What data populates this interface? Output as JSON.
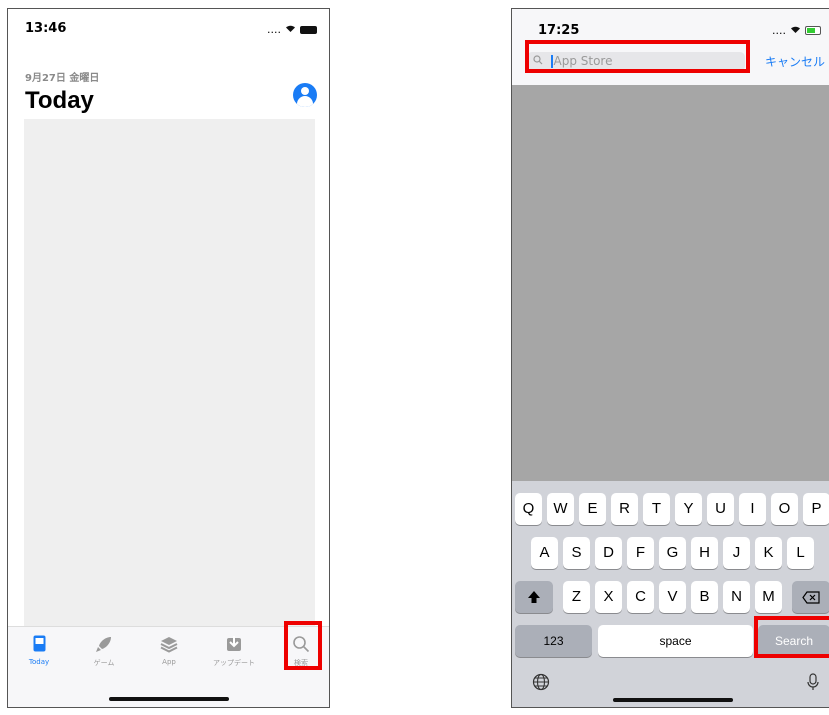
{
  "phone1": {
    "time": "13:46",
    "date": "9月27日 金曜日",
    "title": "Today",
    "tabs": [
      {
        "label": "Today",
        "icon": "today-icon"
      },
      {
        "label": "ゲーム",
        "icon": "rocket-icon"
      },
      {
        "label": "App",
        "icon": "layers-icon"
      },
      {
        "label": "アップデート",
        "icon": "download-icon"
      },
      {
        "label": "検索",
        "icon": "search-icon"
      }
    ]
  },
  "phone2": {
    "time": "17:25",
    "search_placeholder": "App Store",
    "cancel": "キャンセル",
    "keyboard": {
      "row1": [
        "Q",
        "W",
        "E",
        "R",
        "T",
        "Y",
        "U",
        "I",
        "O",
        "P"
      ],
      "row2": [
        "A",
        "S",
        "D",
        "F",
        "G",
        "H",
        "J",
        "K",
        "L"
      ],
      "row3": [
        "Z",
        "X",
        "C",
        "V",
        "B",
        "N",
        "M"
      ],
      "numbers": "123",
      "space": "space",
      "search": "Search"
    }
  },
  "colors": {
    "accent": "#1a7cf5",
    "highlight": "#e00000"
  }
}
